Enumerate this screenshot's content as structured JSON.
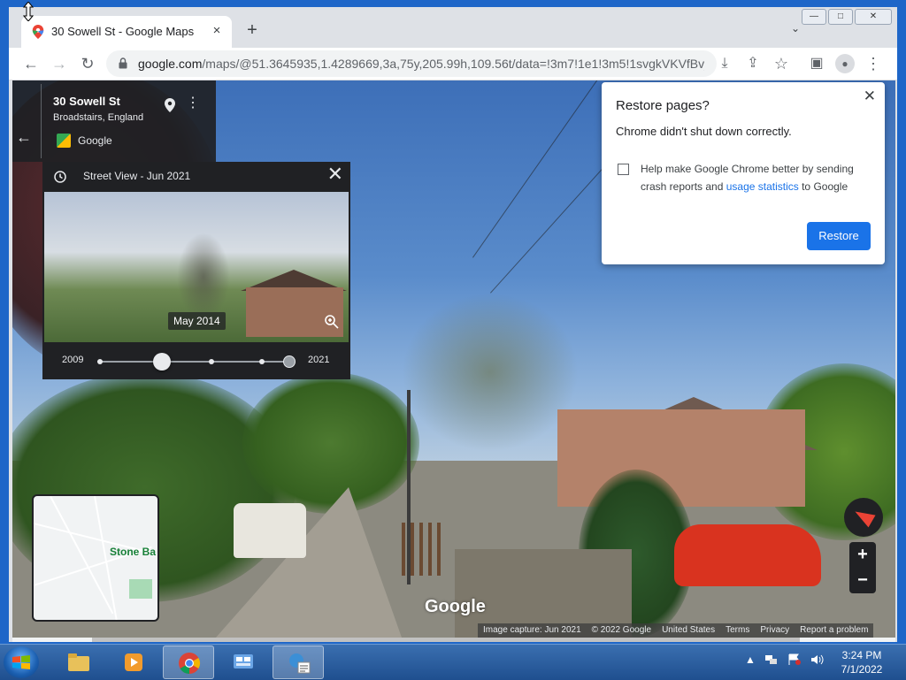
{
  "browser": {
    "tab_title": "30 Sowell St - Google Maps",
    "tab_close": "×",
    "new_tab": "+",
    "tab_search": "⌄",
    "window_buttons": {
      "minimize": "—",
      "maximize": "□",
      "close": "✕"
    },
    "url_domain": "google.com",
    "url_path": "/maps/@51.3645935,1.4289669,3a,75y,205.99h,109.56t/data=!3m7!1e1!3m5!1svgkVKVfBv_..."
  },
  "toolbar": {
    "back": "←",
    "forward": "→",
    "reload": "↻",
    "install": "⤓",
    "share": "⇪",
    "bookmark": "☆",
    "sidepanel": "▣",
    "profile": "●",
    "menu": "⋮"
  },
  "maps_panel": {
    "back": "←",
    "address": "30 Sowell St",
    "location": "Broadstairs, England",
    "source": "Google",
    "more": "⋮"
  },
  "time_machine": {
    "header": "Street View - Jun 2021",
    "close": "✕",
    "thumbnail_label": "May 2014",
    "year_start": "2009",
    "year_end": "2021",
    "selected_fraction": 0.33
  },
  "restore_dialog": {
    "title": "Restore pages?",
    "message": "Chrome didn't shut down correctly.",
    "help_prefix": "Help make Google Chrome better by sending crash reports and ",
    "help_link": "usage statistics",
    "help_suffix": " to Google",
    "button": "Restore",
    "close": "✕",
    "checkbox_checked": false
  },
  "minimap": {
    "label": "Stone Ba"
  },
  "map_controls": {
    "zoom_in": "+",
    "zoom_out": "−"
  },
  "branding": {
    "logo": "Google"
  },
  "footer": {
    "items": [
      "Image capture: Jun 2021",
      "© 2022 Google",
      "United States",
      "Terms",
      "Privacy",
      "Report a problem"
    ]
  },
  "tray": {
    "show_hidden": "▲",
    "time": "3:24 PM",
    "date": "7/1/2022"
  },
  "colors": {
    "accent": "#1a73e8",
    "street_view_red": "#ea4335",
    "chrome_frame": "#dee1e6",
    "maps_dark": "#202124"
  }
}
